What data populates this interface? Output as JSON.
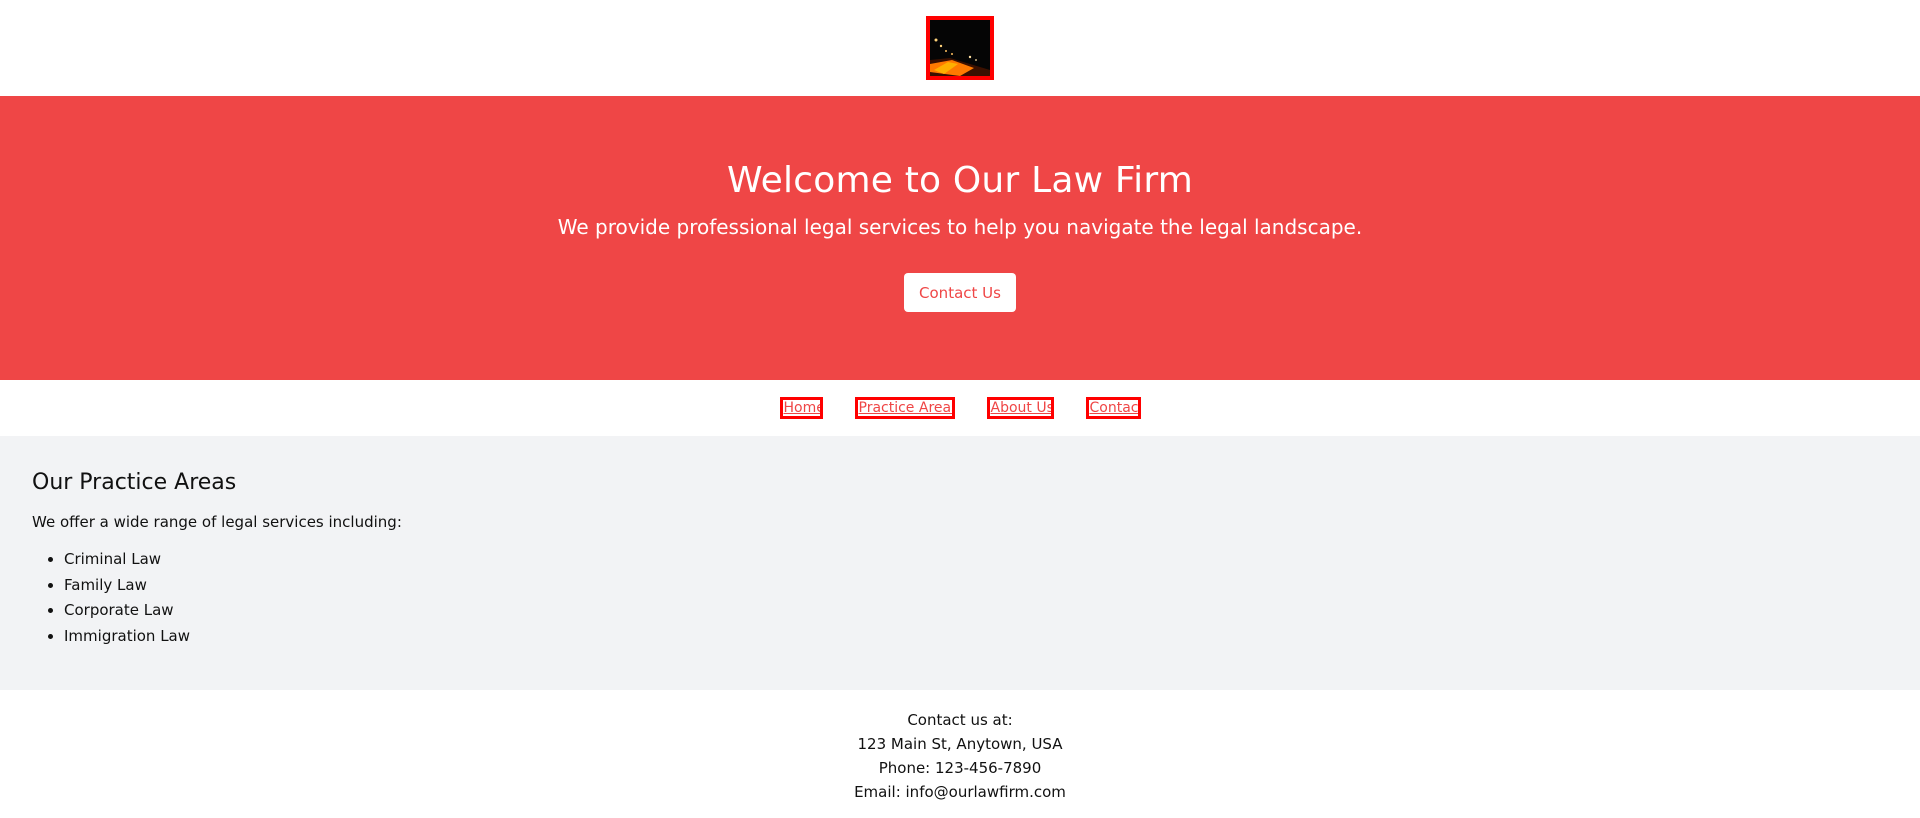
{
  "logo": {
    "icon": "night-road-image-icon",
    "border_color": "#ff0000"
  },
  "hero": {
    "title": "Welcome to Our Law Firm",
    "subtitle": "We provide professional legal services to help you navigate the legal landscape.",
    "cta_label": "Contact Us",
    "background_color": "#ef4646"
  },
  "nav": {
    "items": [
      {
        "label": "Home"
      },
      {
        "label": "Practice Areas"
      },
      {
        "label": "About Us"
      },
      {
        "label": "Contact"
      }
    ]
  },
  "practice": {
    "title": "Our Practice Areas",
    "intro": "We offer a wide range of legal services including:",
    "areas": [
      "Criminal Law",
      "Family Law",
      "Corporate Law",
      "Immigration Law"
    ]
  },
  "footer": {
    "heading": "Contact us at:",
    "address": "123 Main St, Anytown, USA",
    "phone": "Phone: 123-456-7890",
    "email": "Email: info@ourlawfirm.com"
  }
}
